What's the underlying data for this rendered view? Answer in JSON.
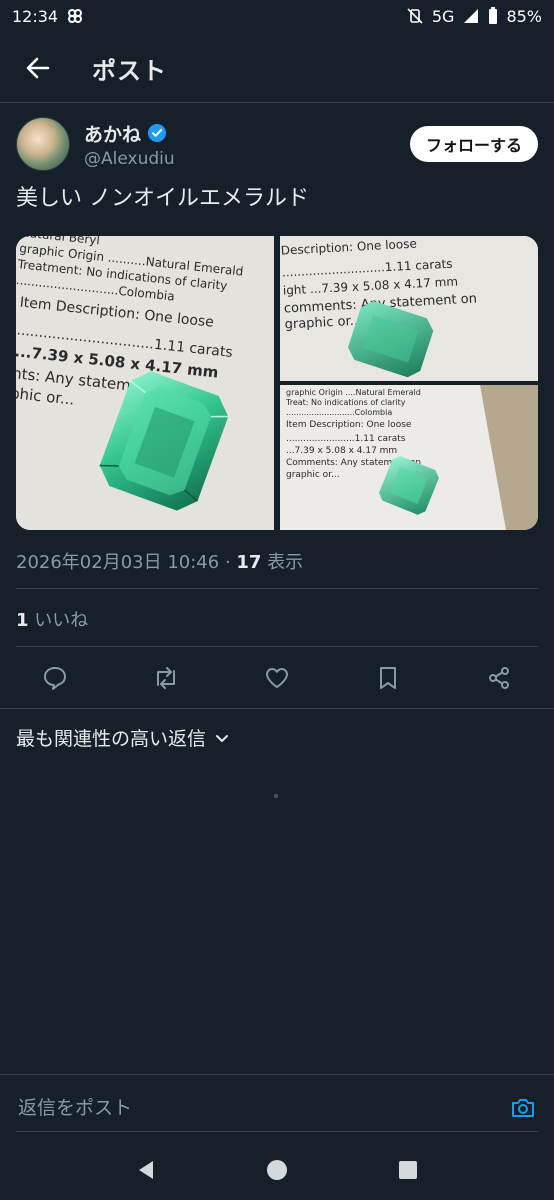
{
  "status_bar": {
    "time": "12:34",
    "network": "5G",
    "battery": "85%"
  },
  "header": {
    "title": "ポスト"
  },
  "post": {
    "author": {
      "display_name": "あかね",
      "handle": "@Alexudiu"
    },
    "follow_label": "フォローする",
    "text": "美しい ノンオイルエメラルド",
    "media": {
      "img1": {
        "lines": [
          "Natural Beryl",
          "graphic Origin ..........Natural Emerald",
          "Treatment: No indications of clarity",
          "...........................Colombia",
          "Item Description: One loose",
          "...............................1.11 carats",
          "...7.39 x 5.08 x 4.17 mm",
          "nts: Any statement on",
          "phic or..."
        ]
      },
      "img2": {
        "lines": [
          "Description: One loose",
          "...........................1.11 carats",
          "ight ...7.39 x 5.08 x 4.17 mm",
          "comments: Any statement on",
          "graphic or..."
        ]
      },
      "img3": {
        "lines": [
          "graphic Origin ....Natural Emerald",
          "Treat: No indications of clarity",
          "...........................Colombia",
          "Item Description: One loose",
          "........................1.11 carats",
          "...7.39 x 5.08 x 4.17 mm",
          "Comments: Any statement on",
          "graphic or..."
        ]
      }
    },
    "timestamp": "2026年02月03日 10:46",
    "separator": " · ",
    "views_count": "17",
    "views_label": " 表示",
    "likes_count": "1",
    "likes_label": " いいね"
  },
  "replies": {
    "sort_label": "最も関連性の高い返信"
  },
  "reply_bar": {
    "placeholder": "返信をポスト"
  },
  "colors": {
    "background": "#15202b",
    "accent": "#1d9bf0",
    "verified": "#1d9bf0",
    "emerald": "#3fd6a0"
  },
  "icons": [
    "back-arrow-icon",
    "verified-badge-icon",
    "reply-icon",
    "retweet-icon",
    "like-icon",
    "bookmark-icon",
    "share-icon",
    "chevron-down-icon",
    "camera-icon",
    "nav-back-icon",
    "nav-home-icon",
    "nav-recents-icon"
  ]
}
